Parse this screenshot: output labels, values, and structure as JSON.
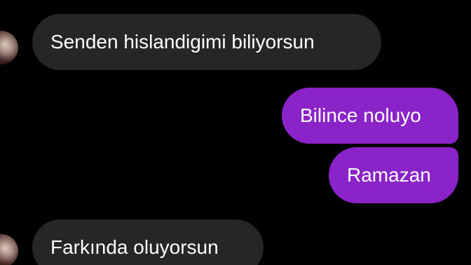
{
  "conversation": {
    "messages": [
      {
        "direction": "incoming",
        "text": "Senden hislandigimi biliyorsun"
      },
      {
        "direction": "outgoing",
        "text": "Bilince noluyo"
      },
      {
        "direction": "outgoing",
        "text": "Ramazan"
      },
      {
        "direction": "incoming",
        "text": "Farkında oluyorsun"
      }
    ]
  },
  "colors": {
    "background": "#000000",
    "incoming_bubble": "#262626",
    "outgoing_bubble": "#8a24c8",
    "text": "#ffffff"
  }
}
